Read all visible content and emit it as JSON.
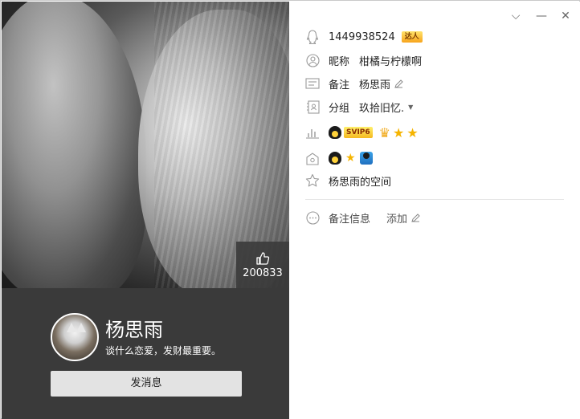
{
  "profile": {
    "qq_number": "1449938524",
    "talent_badge": "达人",
    "nickname_label": "昵称",
    "nickname": "柑橘与柠檬啊",
    "remark_label": "备注",
    "remark": "杨思雨",
    "group_label": "分组",
    "group": "玖拾旧忆.",
    "svip_badge": "SVIP6",
    "space_link": "杨思雨的空间",
    "note_label": "备注信息",
    "note_add": "添加"
  },
  "card": {
    "display_name": "杨思雨",
    "signature": "谈什么恋爱，发财最重要。",
    "like_count": "200833",
    "send_message_label": "发消息"
  },
  "window": {
    "chevron": "⌵",
    "minimize": "—",
    "close": "✕"
  },
  "colors": {
    "left_panel_bg": "#3a3a3a",
    "icon_gray": "#9a9a9a",
    "badge_orange": "#f7a41c",
    "star_gold": "#f5b400"
  },
  "icons": [
    "qq-penguin-icon",
    "user-circle-icon",
    "id-card-icon",
    "group-icon",
    "level-chart-icon",
    "vip-house-icon",
    "star-outline-icon",
    "more-circle-icon",
    "thumb-up-icon",
    "pencil-icon",
    "dropdown-caret-icon"
  ]
}
